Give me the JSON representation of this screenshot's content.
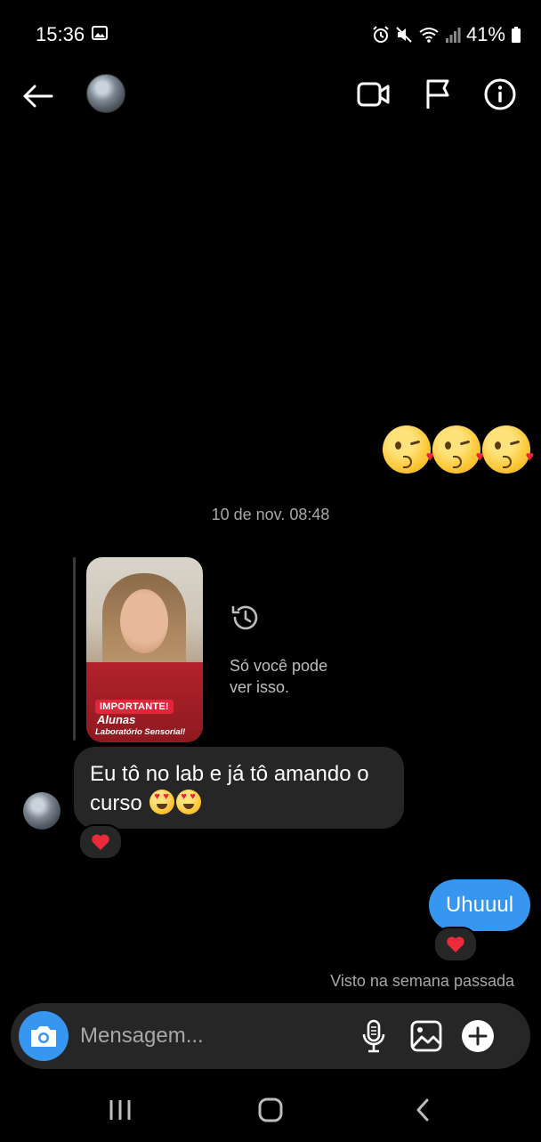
{
  "status_bar": {
    "time": "15:36",
    "battery": "41%",
    "icons": [
      "image-icon",
      "alarm-icon",
      "mute-icon",
      "wifi-icon",
      "signal-icon",
      "battery-icon"
    ]
  },
  "header": {
    "icons": [
      "back-arrow-icon",
      "avatar",
      "video-camera-icon",
      "flag-icon",
      "info-icon"
    ]
  },
  "messages": {
    "sent_emojis": "😘😘😘",
    "timestamp": "10 de nov. 08:48",
    "story": {
      "tag_important": "IMPORTANTE!",
      "tag_title": "Alunas",
      "tag_subtitle": "Laboratório Sensorial!",
      "only_you": "Só você pode ver isso."
    },
    "received_text": "Eu tô no lab e já tô amando o curso",
    "received_emojis": "😍😍",
    "received_reaction": "❤️",
    "sent_text": "Uhuuul",
    "sent_reaction": "❤️",
    "seen": "Visto na semana passada"
  },
  "composer": {
    "placeholder": "Mensagem..."
  },
  "colors": {
    "background": "#000000",
    "bubble_received": "#262626",
    "bubble_sent": "#3797f0",
    "reaction_heart": "#ec2a3c"
  }
}
